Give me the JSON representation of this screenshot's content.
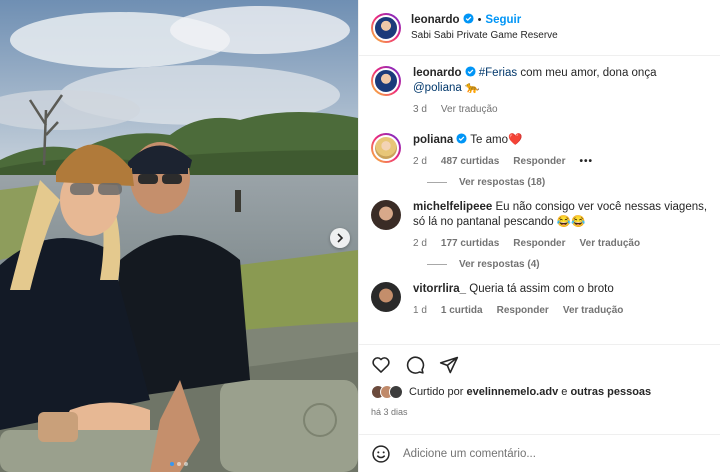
{
  "post": {
    "author": "leonardo",
    "follow_label": "Seguir",
    "separator": "•",
    "location": "Sabi Sabi Private Game Reserve",
    "image_dots": 3,
    "active_dot": 0
  },
  "caption": {
    "author": "leonardo",
    "hashtag": "#Ferias",
    "text_mid": " com meu amor, dona onça ",
    "mention": "@poliana",
    "emoji": "🐆",
    "time": "3 d",
    "translate": "Ver tradução"
  },
  "comments": [
    {
      "author": "poliana",
      "text": "Te amo",
      "emoji": "❤️",
      "time": "2 d",
      "likes": "487 curtidas",
      "reply": "Responder",
      "more": "•••",
      "view_replies": "Ver respostas (18)"
    },
    {
      "author": "michelfelipeee",
      "text": "Eu não consigo ver você nessas viagens, só lá no pantanal pescando",
      "emoji": "😂😂",
      "time": "2 d",
      "likes": "177 curtidas",
      "reply": "Responder",
      "translate": "Ver tradução",
      "view_replies": "Ver respostas (4)"
    },
    {
      "author": "vitorrlira_",
      "text": "Queria tá assim com o broto",
      "time": "1 d",
      "likes": "1 curtida",
      "reply": "Responder",
      "translate": "Ver tradução"
    }
  ],
  "likes": {
    "prefix": "Curtido por",
    "user": "evelinnemelo.adv",
    "suffix": "e",
    "others": "outras pessoas"
  },
  "posted_ago": "há 3 dias",
  "add_comment": {
    "placeholder": "Adicione um comentário..."
  },
  "colors": {
    "link": "#0095f6",
    "mention": "#00376b",
    "verified": "#0095f6",
    "muted": "#737373"
  },
  "icons": [
    "verified-icon",
    "heart-icon",
    "comment-icon",
    "share-icon",
    "emoji-icon",
    "chevron-right-icon"
  ]
}
